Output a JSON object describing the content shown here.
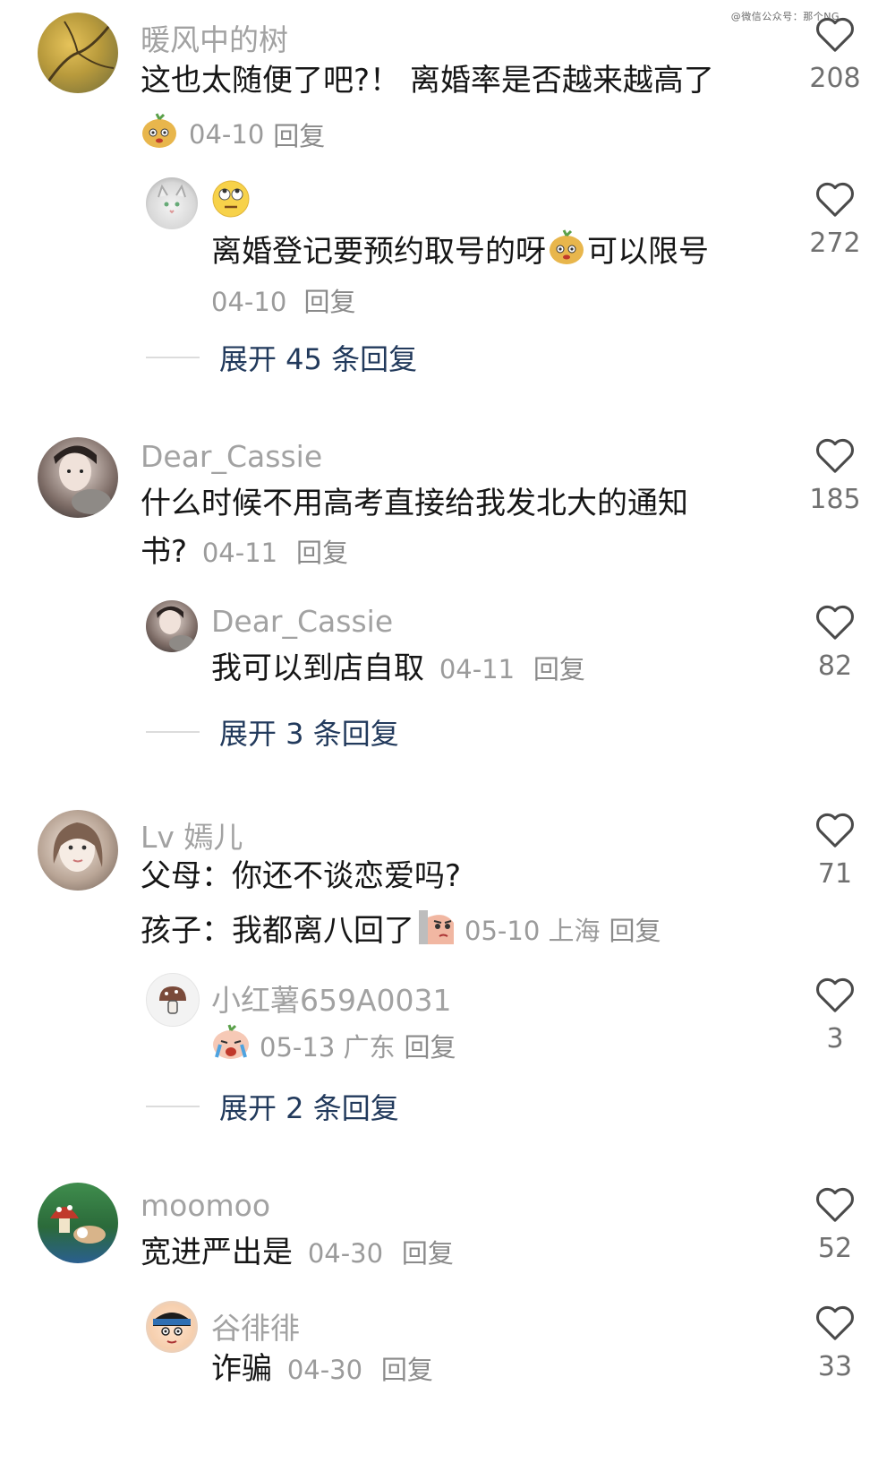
{
  "watermark": "@微信公众号：那个NG",
  "comments": [
    {
      "username": "暖风中的树",
      "text": "这也太随便了吧?！ 离婚率是否越来越高了",
      "meta": "04-10",
      "reply": "回复",
      "likes": "208",
      "replies": [
        {
          "text_a": "离婚登记要预约取号的呀",
          "text_b": "可以限号",
          "meta": "04-10",
          "reply": "回复",
          "likes": "272"
        }
      ],
      "expand": "展开 45 条回复"
    },
    {
      "username": "Dear_Cassie",
      "text_line1": "什么时候不用高考直接给我发北大的通知",
      "text_line2": "书?",
      "meta": "04-11",
      "reply": "回复",
      "likes": "185",
      "replies": [
        {
          "username": "Dear_Cassie",
          "text": "我可以到店自取",
          "meta": "04-11",
          "reply": "回复",
          "likes": "82"
        }
      ],
      "expand": "展开 3 条回复"
    },
    {
      "username": "Lv 嫣儿",
      "text_line1": "父母：你还不谈恋爱吗?",
      "text_line2": "孩子：我都离八回了",
      "meta": "05-10 上海",
      "reply": "回复",
      "likes": "71",
      "replies": [
        {
          "username": "小红薯659A0031",
          "meta": "05-13 广东",
          "reply": "回复",
          "likes": "3"
        }
      ],
      "expand": "展开 2 条回复"
    },
    {
      "username": "moomoo",
      "text": "宽进严出是",
      "meta": "04-30",
      "reply": "回复",
      "likes": "52",
      "replies": [
        {
          "username": "谷徘徘",
          "text": "诈骗",
          "meta": "04-30",
          "reply": "回复",
          "likes": "33"
        }
      ]
    }
  ]
}
